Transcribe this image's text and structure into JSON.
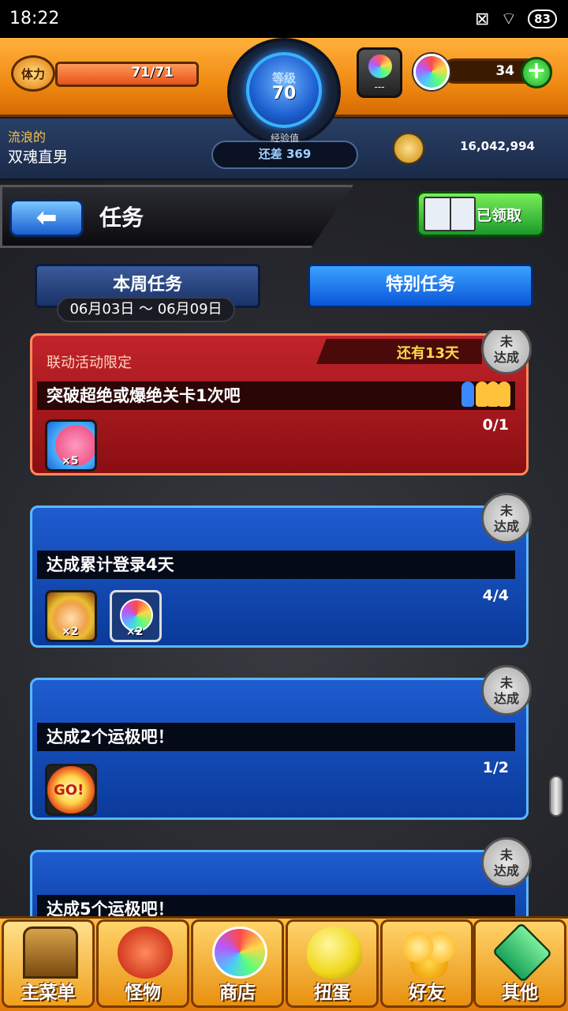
{
  "status_bar": {
    "time": "18:22",
    "battery": "83"
  },
  "header": {
    "stamina_label": "体力",
    "stamina": "71/71",
    "stamina_fill": 1.0,
    "level_label": "等级",
    "level": "70",
    "exp_label": "经验值",
    "exp_remaining": "还差 369",
    "gacha_text": "---",
    "orbs": "34",
    "player_title_line1": "流浪的",
    "player_title_line2": "双魂直男",
    "gold": "16,042,994"
  },
  "page": {
    "title": "任务",
    "claimed_button": "已领取"
  },
  "tabs": {
    "weekly": "本周任务",
    "special": "特别任务",
    "active": "special",
    "date_range": "06月03日 ～ 06月09日"
  },
  "missions": [
    {
      "limited_label": "联动活动限定",
      "remaining": "还有13天",
      "title": "突破超绝或爆绝关卡1次吧",
      "progress": "0/1",
      "stamp": "未\n达成",
      "rewards": [
        {
          "type": "character",
          "mult": "×5"
        }
      ]
    },
    {
      "title": "达成累计登录4天",
      "progress": "4/4",
      "stamp": "未\n达成",
      "rewards": [
        {
          "type": "character",
          "mult": "×2"
        },
        {
          "type": "orb",
          "mult": "×2"
        }
      ]
    },
    {
      "title": "达成2个运极吧！",
      "progress": "1/2",
      "stamp": "未\n达成",
      "rewards": [
        {
          "type": "go",
          "label": "GO!"
        }
      ]
    },
    {
      "title": "达成5个运极吧！",
      "stamp": "未\n达成"
    }
  ],
  "nav": [
    {
      "label": "主菜单",
      "icon": "home-icon"
    },
    {
      "label": "怪物",
      "icon": "monster-icon"
    },
    {
      "label": "商店",
      "icon": "shop-orb-icon"
    },
    {
      "label": "扭蛋",
      "icon": "gacha-egg-icon"
    },
    {
      "label": "好友",
      "icon": "friends-icon"
    },
    {
      "label": "其他",
      "icon": "other-icon"
    }
  ]
}
